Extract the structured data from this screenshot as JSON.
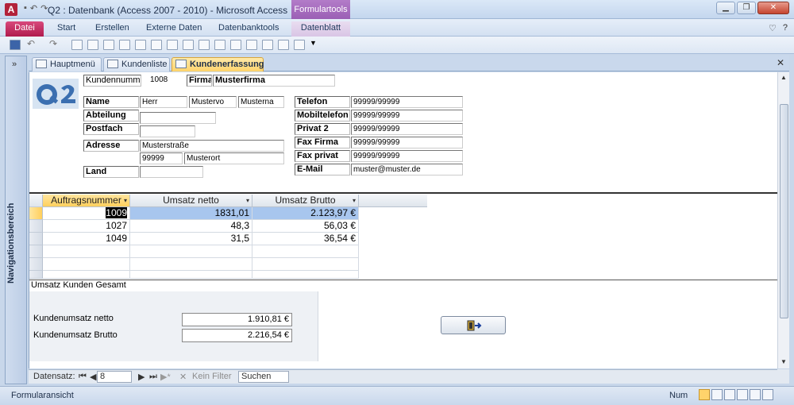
{
  "window": {
    "app_icon": "A",
    "title": "Q2 : Datenbank (Access 2007 - 2010)  -  Microsoft Access",
    "context_tab": "Formulartools"
  },
  "ribbon": {
    "tabs": [
      "Datei",
      "Start",
      "Erstellen",
      "Externe Daten",
      "Datenbanktools",
      "Datenblatt"
    ]
  },
  "navigation_pane": {
    "label": "Navigationsbereich",
    "collapse_glyph": "»"
  },
  "doc_tabs": [
    "Hauptmenü",
    "Kundenliste",
    "Kundenerfassung"
  ],
  "form": {
    "kundennummer_label": "Kundennummer",
    "kundennummer_value": "1008",
    "firma_label": "Firma",
    "firma_value": "Musterfirma",
    "name_label": "Name",
    "anrede": "Herr",
    "vorname": "Mustervo",
    "nachname": "Musterna",
    "abteilung_label": "Abteilung",
    "abteilung_value": "",
    "postfach_label": "Postfach",
    "postfach_value": "",
    "adresse_label": "Adresse",
    "strasse": "Musterstraße",
    "plz": "99999",
    "ort": "Musterort",
    "land_label": "Land",
    "land_value": "",
    "telefon_label": "Telefon",
    "telefon_value": "99999/99999",
    "mobil_label": "Mobiltelefon",
    "mobil_value": "99999/99999",
    "privat2_label": "Privat 2",
    "privat2_value": "99999/99999",
    "faxfirma_label": "Fax Firma",
    "faxfirma_value": "99999/99999",
    "faxprivat_label": "Fax privat",
    "faxprivat_value": "99999/99999",
    "email_label": "E-Mail",
    "email_value": "muster@muster.de"
  },
  "orders": {
    "columns": [
      "Auftragsnummer",
      "Umsatz netto",
      "Umsatz Brutto"
    ],
    "rows": [
      [
        "1009",
        "1831,01",
        "2.123,97 €"
      ],
      [
        "1027",
        "48,3",
        "56,03 €"
      ],
      [
        "1049",
        "31,5",
        "36,54 €"
      ]
    ]
  },
  "totals": {
    "title": "Umsatz Kunden Gesamt",
    "netto_label": "Kundenumsatz netto",
    "netto_value": "1.910,81 €",
    "brutto_label": "Kundenumsatz Brutto",
    "brutto_value": "2.216,54 €"
  },
  "record_nav": {
    "label": "Datensatz:",
    "current": "8",
    "filter": "Kein Filter",
    "search": "Suchen"
  },
  "status": {
    "view": "Formularansicht",
    "num": "Num"
  }
}
